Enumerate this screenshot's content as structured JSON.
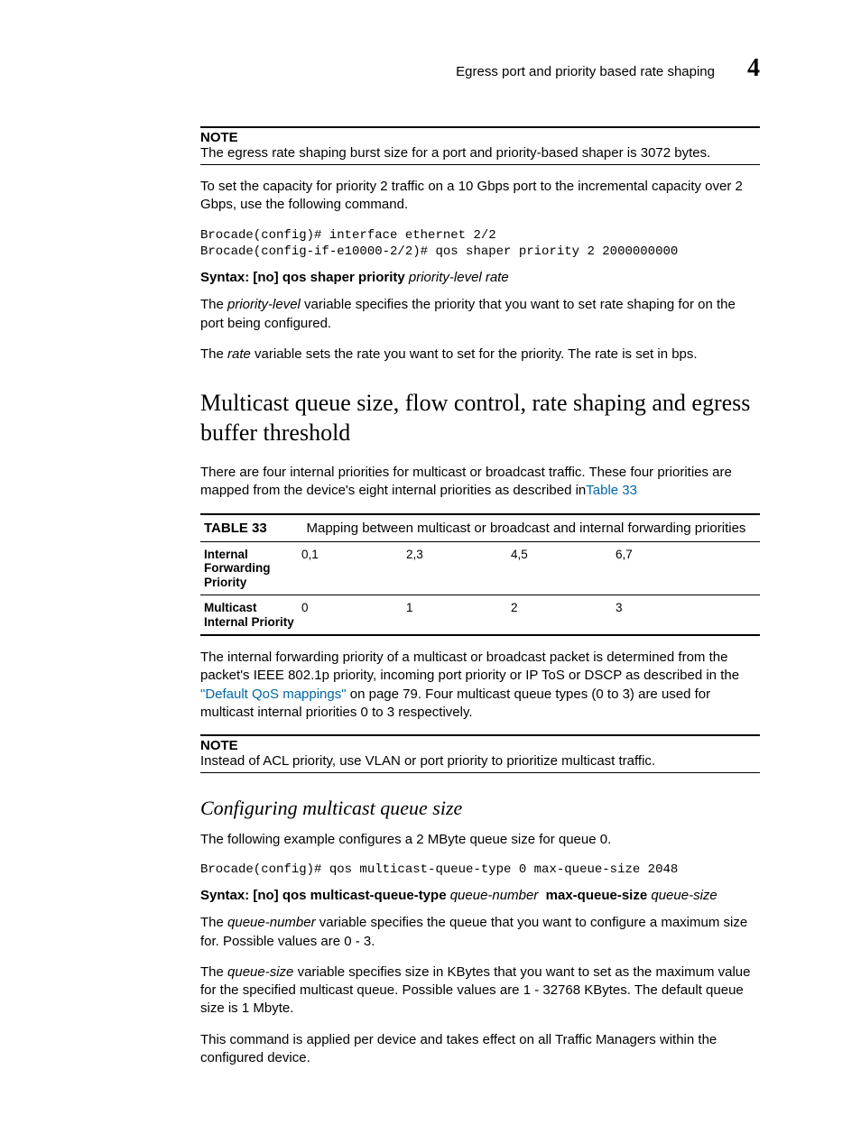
{
  "header": {
    "title": "Egress port and priority based rate shaping",
    "chapter": "4"
  },
  "note1": {
    "label": "NOTE",
    "text": "The egress rate shaping burst size for a port and priority-based shaper is 3072 bytes."
  },
  "para_intro": "To set the capacity for priority 2 traffic on a 10 Gbps port to the incremental capacity over 2 Gbps, use the following command.",
  "code1": "Brocade(config)# interface ethernet 2/2\nBrocade(config-if-e10000-2/2)# qos shaper priority 2 2000000000",
  "syntax1": {
    "prefix": "Syntax:  ",
    "bold1": "[no] qos shaper priority",
    "ital1": "priority-level  rate"
  },
  "para_priority": {
    "pre": "The ",
    "ital": "priority-level",
    "post": " variable specifies the priority that you want to set rate shaping for on the port being configured."
  },
  "para_rate": {
    "pre": "The ",
    "ital": "rate",
    "post": " variable sets the rate you want to set for the priority. The rate is set in bps."
  },
  "h2": "Multicast queue size, flow control, rate shaping and egress buffer threshold",
  "para_mcast": {
    "pre": "There are four internal priorities for multicast or broadcast traffic. These four priorities are mapped from the device's eight internal priorities as described in",
    "link": "Table 33"
  },
  "table": {
    "caption_label": "TABLE 33",
    "caption_text": "Mapping between multicast or broadcast and internal forwarding priorities",
    "rows": [
      {
        "label": "Internal Forwarding Priority",
        "cells": [
          "0,1",
          "2,3",
          "4,5",
          "6,7"
        ]
      },
      {
        "label": "Multicast Internal Priority",
        "cells": [
          "0",
          "1",
          "2",
          "3"
        ]
      }
    ]
  },
  "para_after_table": {
    "pre": "The internal forwarding priority of a multicast or broadcast packet is determined from the packet's IEEE 802.1p priority, incoming port priority or IP ToS or DSCP as described in the ",
    "link": "\"Default QoS mappings\"",
    "post": " on page 79. Four multicast queue types (0 to 3) are used for multicast internal priorities 0 to 3 respectively."
  },
  "note2": {
    "label": "NOTE",
    "text": "Instead of ACL priority, use VLAN or port priority to prioritize multicast traffic."
  },
  "h3": "Configuring multicast queue size",
  "para_example": "The following example configures a 2 MByte queue size for queue 0.",
  "code2": "Brocade(config)# qos multicast-queue-type 0 max-queue-size 2048",
  "syntax2": {
    "prefix": "Syntax:  ",
    "bold1": "[no] qos multicast-queue-type",
    "ital1": "queue-number",
    "bold2": "max-queue-size",
    "ital2": "queue-size"
  },
  "para_qnum": {
    "pre": "The ",
    "ital": "queue-number",
    "post": " variable specifies the queue that you want to configure a maximum size for. Possible values are 0 - 3."
  },
  "para_qsize": {
    "pre": "The ",
    "ital": "queue-size",
    "post": " variable specifies size in KBytes that you want to set as the maximum value for the specified multicast queue. Possible values are 1 - 32768 KBytes. The default queue size is 1 Mbyte."
  },
  "para_device": "This command is applied per device and takes effect on all Traffic Managers within the configured device."
}
